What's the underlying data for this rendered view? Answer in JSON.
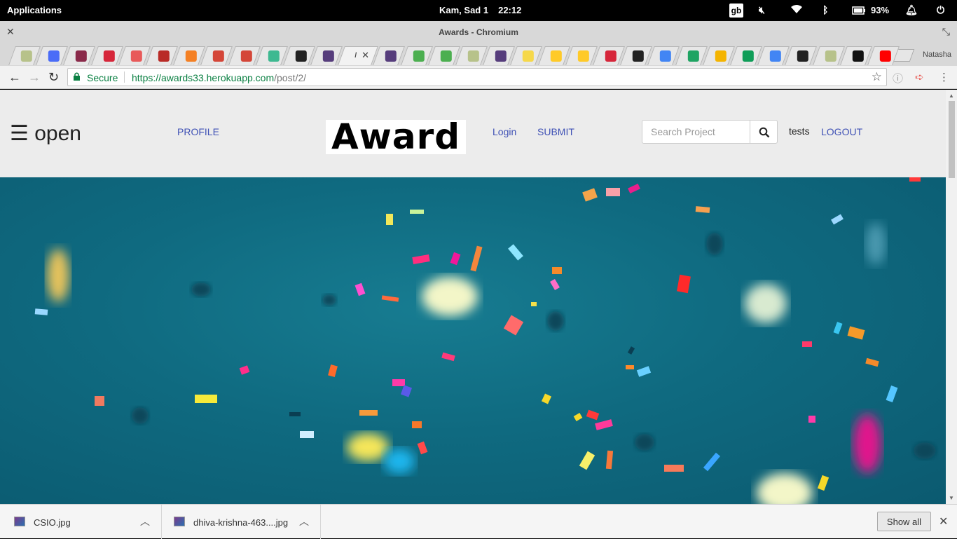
{
  "os": {
    "apps_label": "Applications",
    "date": "Kam, Sad  1",
    "time": "22:12",
    "keyboard_layout": "gb",
    "battery": "93%"
  },
  "window": {
    "title": "Awards - Chromium",
    "profile_name": "Natasha"
  },
  "tabs": {
    "favicons": [
      "tree-icon",
      "docs-icon",
      "hash-icon",
      "angular-icon",
      "openai-icon",
      "quora-icon",
      "stackoverflow-icon",
      "gmail-icon",
      "gmail-icon",
      "slack-icon",
      "github-icon",
      "bootstrap-icon",
      "awards-tab",
      "bootstrap-icon",
      "w3-icon",
      "w3-icon",
      "tree-icon",
      "bootstrap-icon",
      "python-icon",
      "firebase-icon",
      "firebase-icon",
      "angular-icon",
      "github-icon",
      "google-icon",
      "google-drive-icon",
      "slides-icon",
      "sheets-icon",
      "google-icon",
      "camera-icon",
      "tree-icon",
      "medium-icon",
      "youtube-icon"
    ]
  },
  "omnibox": {
    "secure_label": "Secure",
    "url_host": "https://awards33.herokuapp.com",
    "url_path": "/post/2/"
  },
  "site": {
    "open_label": "☰ open",
    "profile_link": "PROFILE",
    "logo_text": "Award",
    "login_link": "Login",
    "submit_link": "SUBMIT",
    "search_placeholder": "Search Project",
    "username": "tests",
    "logout_link": "LOGOUT"
  },
  "downloads": {
    "items": [
      {
        "name": "CSIO.jpg"
      },
      {
        "name": "dhiva-krishna-463....jpg"
      }
    ],
    "show_all_label": "Show all"
  },
  "colors": {
    "link": "#3f51b5",
    "secure_green": "#0b8043",
    "hero_teal": "#0f6a80"
  }
}
